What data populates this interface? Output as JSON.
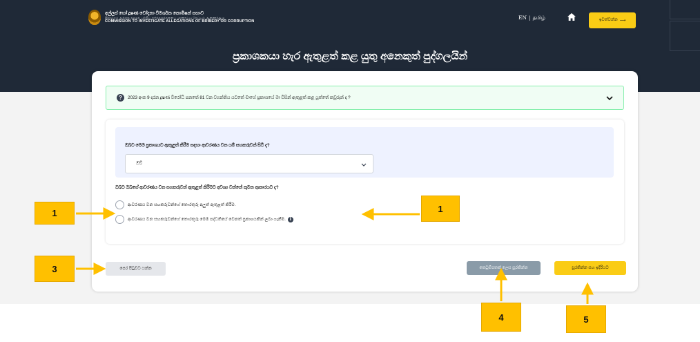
{
  "header": {
    "org_name_sinhala": "අල්ලස් හෝ දූෂණ චෝදනා විමර්ශන කොමිෂන් සභාව",
    "org_name_tamil": "இலஞ்சம் அல்லது ஊழல் பற்றிய சார்த்துதல்களைப் புலனாய்வு செய்யும் ஆணைக்குழு",
    "org_name_english": "COMMISSION TO INVESTIGATE ALLEGATIONS OF BRIBERY OR CORRUPTION",
    "lang_en": "EN",
    "lang_sep": "|",
    "lang_ta": "தமிழ்",
    "signin_label": "ඉවත්වන්න",
    "signin_arrow": "⟶",
    "page_title": "ප්‍රකාශකයා හැර ඇතුළත් කළ යුතු අනෙකුත් පුද්ගලයින්"
  },
  "form": {
    "question_bar_text": "2023 අංක 9 දරන දූෂණ විරෝධී පනතේ 81 වන වගන්තිය යටතේ මාගේ ප්‍රකාශයේ මා විසින් ඇතුළත් කළ යුත්තේ කවුරුන් ද ?",
    "sub_question": "ඔබට මෙම ප්‍රකාශයට ඇතුළත් කිරීම සඳහා ආවරණය වන යම් සහකරුවන් සිටී ද?",
    "select_value": "ඔව්",
    "question_2": "ඔබට ඔබගේ ආවරණය වන සහකරුවන් ඇතුළත් කිරීමට අවශ්‍ය වන්නේ කුමන ආකාරයට ද?",
    "option_1": "ආවරණය වන සහකරුවන්ගේ තොරතුරු අලුත් ඇතුළත් කිරීම.",
    "option_2": "ආවරණය වන සහකරුවන්ගේ තොරතුරු මෙම පද්ධතියේ වෙනත් ප්‍රකාශයකින් ලබා ගැනීම.",
    "info_glyph": "i",
    "back_label": "පෙර පිටුවට යන්න",
    "draft_label": "කෙටුම්පතක් ලෙස සුරකින්න",
    "next_label": "සුරකින්න සහ ඉදිරියට"
  },
  "annotations": {
    "c1_left": "1",
    "c1_right": "1",
    "c3": "3",
    "c4": "4",
    "c5": "5"
  },
  "colors": {
    "header_bg": "#1f2937",
    "accent_yellow": "#facc15",
    "callout": "#ffc000",
    "question_bar_bg": "#f0fdf4",
    "question_bar_border": "#86efac",
    "draft_button": "#8a9ba8"
  },
  "icons": [
    "emblem-logo",
    "home-icon",
    "arrow-right-icon",
    "question-icon",
    "chevron-down-icon",
    "info-icon"
  ]
}
